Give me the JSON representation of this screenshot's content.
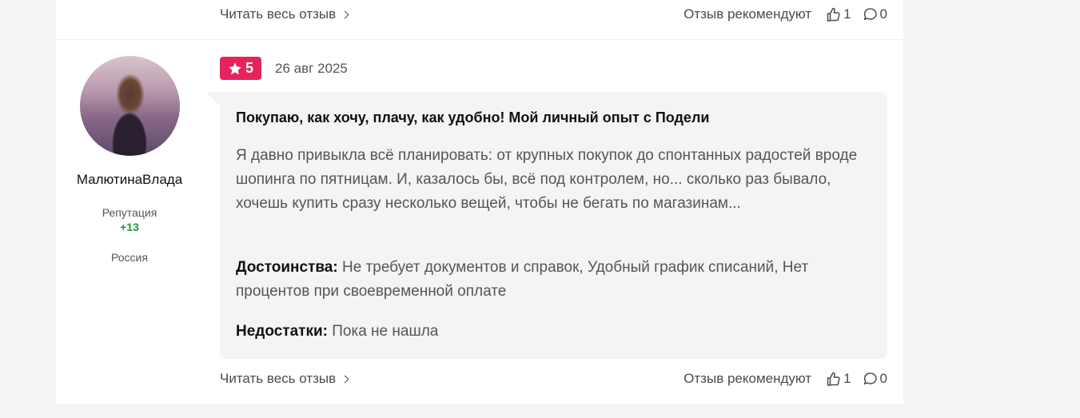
{
  "previous_review_footer": {
    "read_more": "Читать весь отзыв",
    "recommend_label": "Отзыв рекомендуют",
    "likes": "1",
    "comments": "0"
  },
  "review": {
    "author": {
      "name": "МалютинаВлада",
      "reputation_label": "Репутация",
      "reputation_value": "+13",
      "country": "Россия"
    },
    "rating": "5",
    "date": "26 авг 2025",
    "title": "Покупаю, как хочу, плачу, как удобно! Мой личный опыт с Подели",
    "text": "Я давно привыкла всё планировать: от крупных покупок до спонтанных радостей вроде шопинга по пятницам. И, казалось бы, всё под контролем, но... сколько раз бывало, хочешь купить сразу несколько вещей, чтобы не бегать по магазинам...",
    "pros_label": "Достоинства:",
    "pros": "Не требует документов и справок, Удобный график списаний, Нет процентов при своевременной оплате",
    "cons_label": "Недостатки:",
    "cons": "Пока не нашла",
    "footer": {
      "read_more": "Читать весь отзыв",
      "recommend_label": "Отзыв рекомендуют",
      "likes": "1",
      "comments": "0"
    }
  },
  "colors": {
    "rating_badge": "#e5245e",
    "reputation_positive": "#1a9a3b",
    "bubble_bg": "#f4f4f6"
  },
  "icons": [
    "chevron-right-icon",
    "thumbs-up-icon",
    "comment-icon",
    "star-icon"
  ]
}
